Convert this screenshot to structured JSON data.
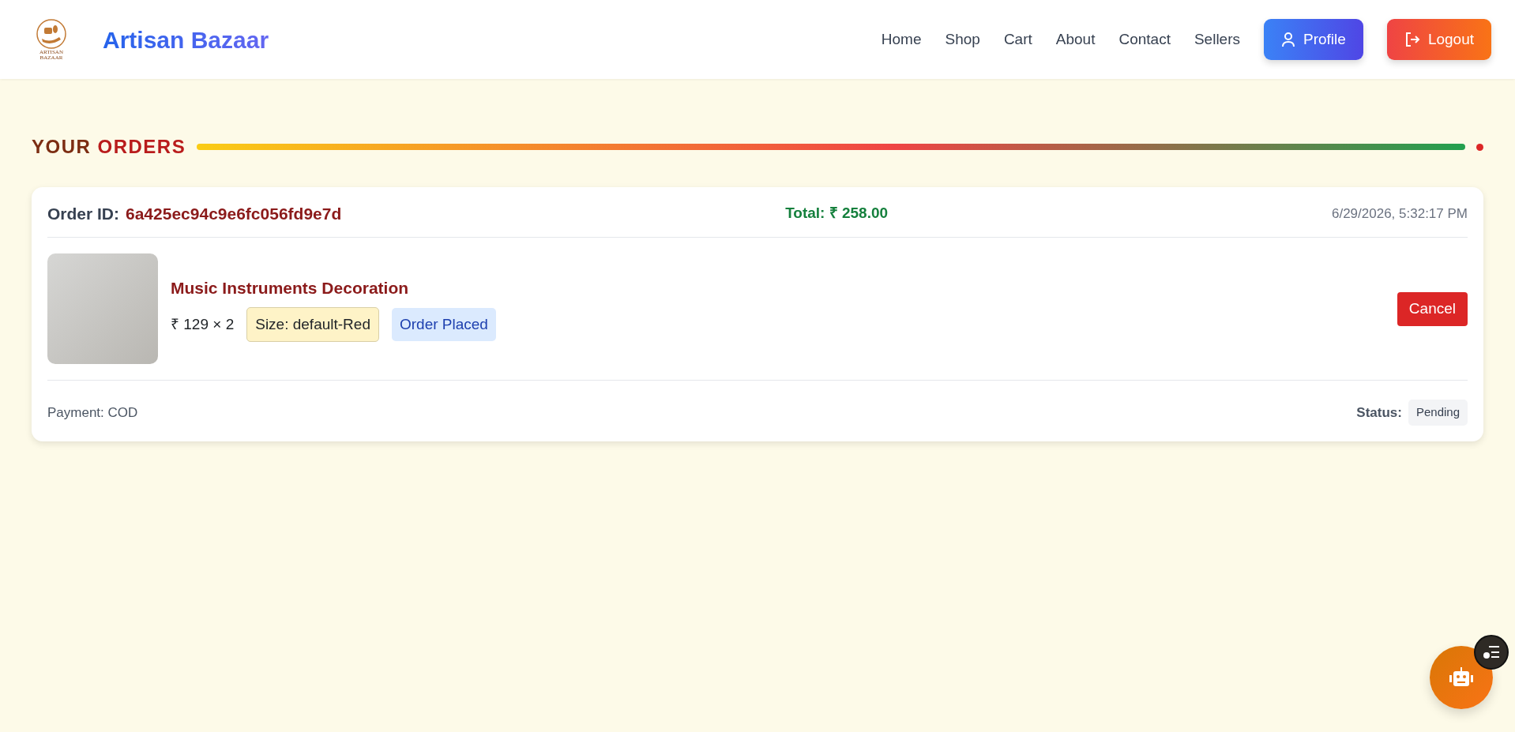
{
  "brand": {
    "logo_text": "ARTISAN BAZAAR",
    "name": "Artisan Bazaar"
  },
  "nav": [
    {
      "label": "Home"
    },
    {
      "label": "Shop"
    },
    {
      "label": "Cart"
    },
    {
      "label": "About"
    },
    {
      "label": "Contact"
    },
    {
      "label": "Sellers"
    }
  ],
  "actions": [
    {
      "kind": "profile",
      "label": "Profile"
    },
    {
      "kind": "logout",
      "label": "Logout"
    }
  ],
  "heading": {
    "first": "YOUR",
    "second": "ORDERS"
  },
  "orders": [
    {
      "id_label": "Order ID:",
      "id": "6a425ec94c9e6fc056fd9e7d",
      "total": "Total: ₹ 258.00",
      "date": "6/29/2026, 5:32:17 PM",
      "items": [
        {
          "name": "Music Instruments Decoration",
          "price": "₹ 129 × 2",
          "size": "Size: default-Red",
          "item_status": "Order Placed",
          "action": "Cancel"
        }
      ],
      "payment": "Payment: COD",
      "status_label": "Status:",
      "status": "Pending"
    }
  ]
}
